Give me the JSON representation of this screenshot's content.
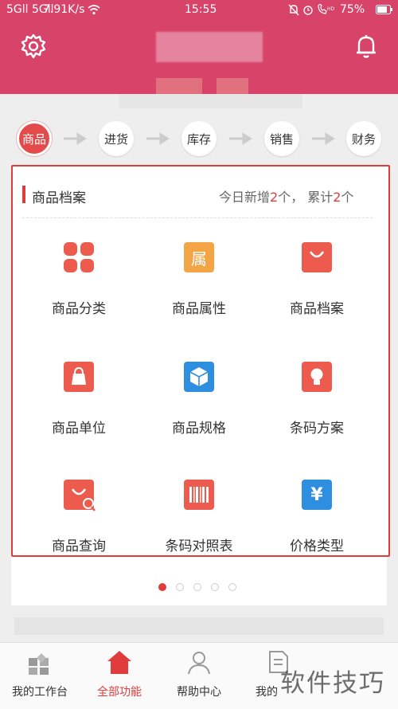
{
  "status_bar": {
    "signal": "5Gll 5Gll",
    "speed": "7.91K/s",
    "time": "15:55",
    "battery": "75%"
  },
  "steps": [
    {
      "label": "商品",
      "active": true
    },
    {
      "label": "进货",
      "active": false
    },
    {
      "label": "库存",
      "active": false
    },
    {
      "label": "销售",
      "active": false
    },
    {
      "label": "财务",
      "active": false
    }
  ],
  "card": {
    "title": "商品档案",
    "stats_prefix": "今日新增",
    "today_count": "2",
    "stats_mid": "个，  累计",
    "total_count": "2",
    "stats_suffix": "个"
  },
  "tiles": [
    {
      "label": "商品分类",
      "icon": "grid-icon",
      "color": "#ec5b4e"
    },
    {
      "label": "商品属性",
      "icon": "attribute-icon",
      "color": "#f3a444",
      "glyph": "属"
    },
    {
      "label": "商品档案",
      "icon": "shopping-bag-icon",
      "color": "#ec5b4e"
    },
    {
      "label": "商品单位",
      "icon": "handbag-icon",
      "color": "#ec5b4e"
    },
    {
      "label": "商品规格",
      "icon": "box-icon",
      "color": "#2e8ee0"
    },
    {
      "label": "条码方案",
      "icon": "lightbulb-icon",
      "color": "#ec5b4e"
    },
    {
      "label": "商品查询",
      "icon": "bag-search-icon",
      "color": "#ec5b4e"
    },
    {
      "label": "条码对照表",
      "icon": "barcode-icon",
      "color": "#ec5b4e"
    },
    {
      "label": "价格类型",
      "icon": "yen-icon",
      "color": "#2e8ee0",
      "glyph": "¥"
    }
  ],
  "pager": {
    "count": 5,
    "active": 0
  },
  "bottom_nav": [
    {
      "label": "我的工作台",
      "icon": "workbench-icon",
      "active": false
    },
    {
      "label": "全部功能",
      "icon": "home-icon",
      "active": true
    },
    {
      "label": "帮助中心",
      "icon": "user-icon",
      "active": false
    },
    {
      "label": "我的",
      "icon": "profile-icon",
      "active": false
    }
  ],
  "watermark": "软件技巧",
  "colors": {
    "header": "#d8436a",
    "accent": "#e03c3c",
    "blue": "#2e8ee0",
    "orange": "#f3a444"
  }
}
